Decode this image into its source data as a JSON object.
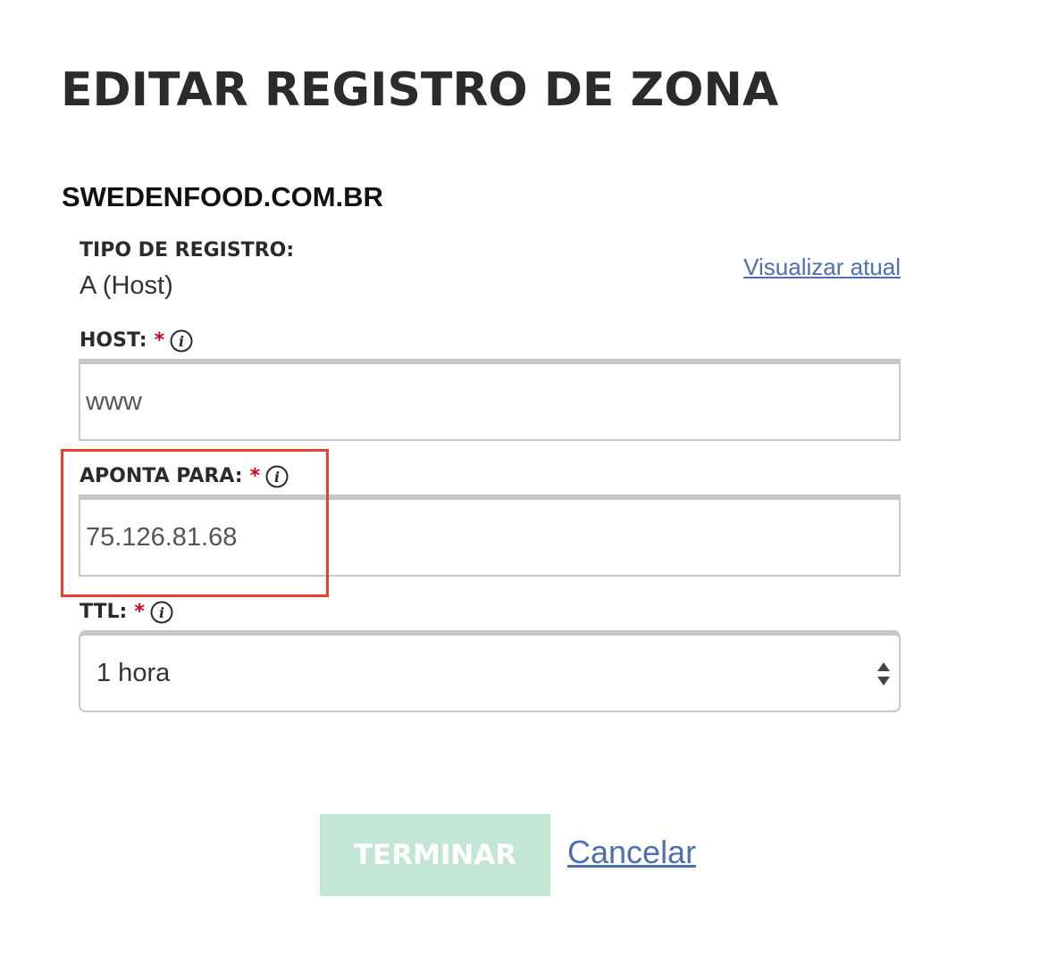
{
  "page": {
    "title": "EDITAR REGISTRO DE ZONA",
    "domain": "SWEDENFOOD.COM.BR"
  },
  "record_type": {
    "label": "TIPO DE REGISTRO:",
    "value": "A (Host)",
    "view_current_link": "Visualizar atual"
  },
  "host": {
    "label": "HOST:",
    "required_mark": "*",
    "value": "www",
    "info_icon": "info-icon"
  },
  "points_to": {
    "label": "APONTA PARA:",
    "required_mark": "*",
    "value": "75.126.81.68",
    "info_icon": "info-icon"
  },
  "ttl": {
    "label": "TTL:",
    "required_mark": "*",
    "selected": "1 hora",
    "info_icon": "info-icon"
  },
  "actions": {
    "submit_label": "TERMINAR",
    "cancel_label": "Cancelar"
  },
  "colors": {
    "required": "#d0021b",
    "link": "#4f6fae",
    "submit_disabled_bg": "#c3e5d4",
    "highlight": "#e8412f"
  }
}
